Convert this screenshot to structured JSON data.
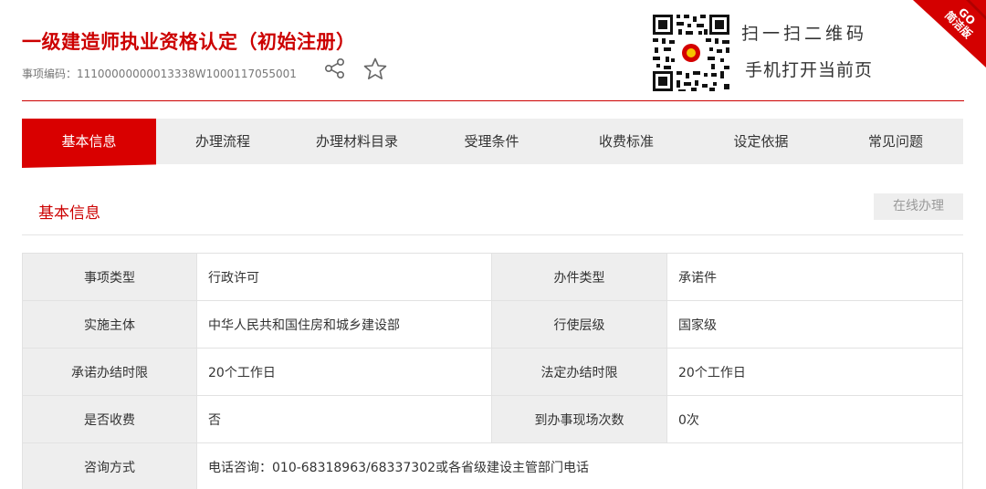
{
  "header": {
    "title": "一级建造师执业资格认定（初始注册）",
    "item_code": "事项编码：11100000000013338W1000117055001"
  },
  "qr": {
    "line1": "扫一扫二维码",
    "line2": "手机打开当前页"
  },
  "corner": {
    "label": "GO\n简洁版"
  },
  "tabs": [
    {
      "label": "基本信息",
      "active": true
    },
    {
      "label": "办理流程"
    },
    {
      "label": "办理材料目录"
    },
    {
      "label": "受理条件"
    },
    {
      "label": "收费标准"
    },
    {
      "label": "设定依据"
    },
    {
      "label": "常见问题"
    }
  ],
  "section": {
    "title": "基本信息",
    "online_button": "在线办理"
  },
  "table": {
    "rows": [
      {
        "l1": "事项类型",
        "v1": "行政许可",
        "l2": "办件类型",
        "v2": "承诺件"
      },
      {
        "l1": "实施主体",
        "v1": "中华人民共和国住房和城乡建设部",
        "l2": "行使层级",
        "v2": "国家级"
      },
      {
        "l1": "承诺办结时限",
        "v1": "20个工作日",
        "l2": "法定办结时限",
        "v2": "20个工作日"
      },
      {
        "l1": "是否收费",
        "v1": "否",
        "l2": "到办事现场次数",
        "v2": "0次"
      }
    ],
    "consult": {
      "label": "咨询方式",
      "value": "电话咨询：010-68318963/68337302或各省级建设主管部门电话"
    }
  },
  "colors": {
    "accent": "#cc0000",
    "tab_active": "#d90000",
    "tab_bg": "#eeeeee"
  }
}
